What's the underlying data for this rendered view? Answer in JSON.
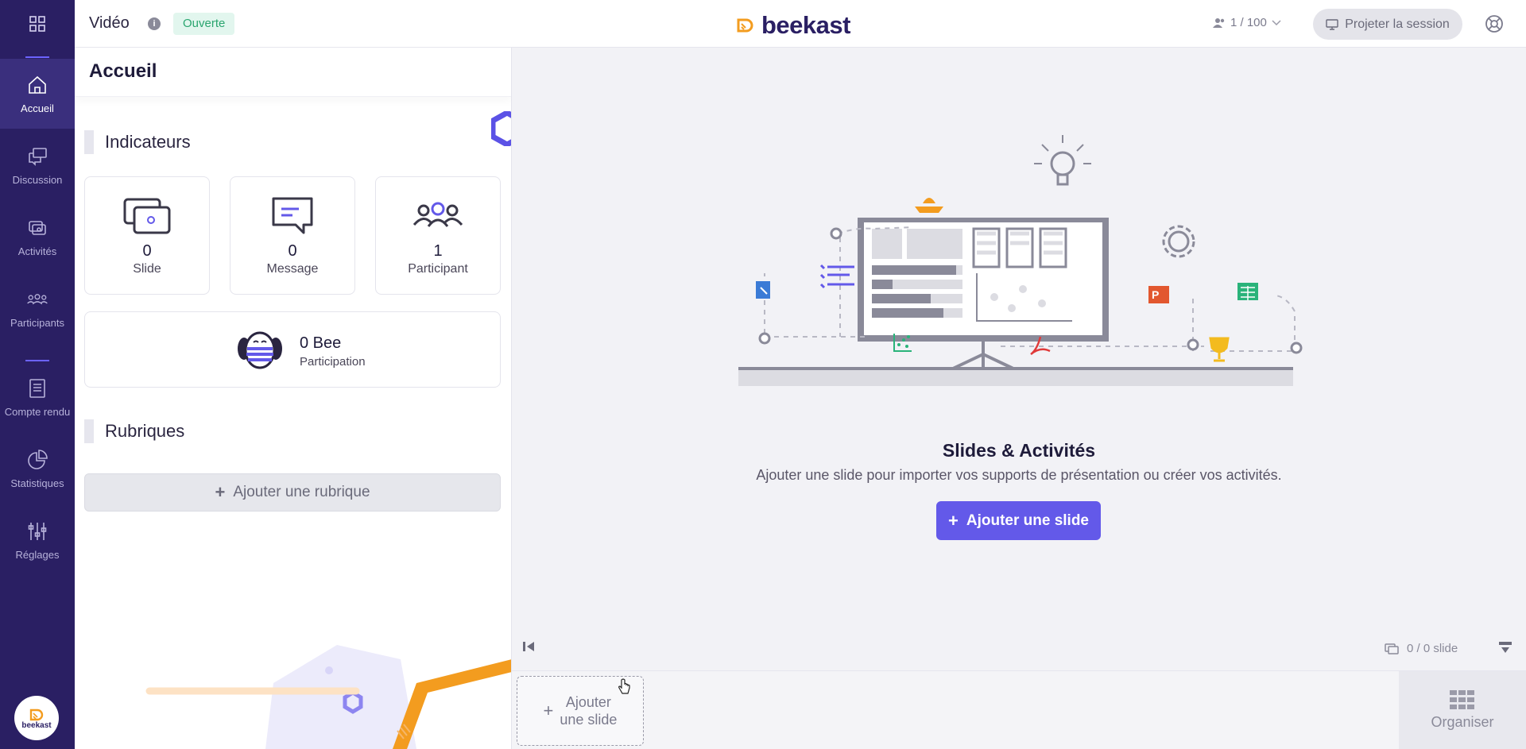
{
  "sidebar": {
    "apps_icon": "apps-grid-icon",
    "items": [
      {
        "label": "Accueil",
        "icon": "home-icon",
        "active": true
      },
      {
        "label": "Discussion",
        "icon": "chat-icon"
      },
      {
        "label": "Activités",
        "icon": "activities-icon"
      },
      {
        "label": "Participants",
        "icon": "participants-icon"
      },
      {
        "label": "Compte rendu",
        "icon": "report-icon"
      },
      {
        "label": "Statistiques",
        "icon": "pie-chart-icon"
      },
      {
        "label": "Réglages",
        "icon": "sliders-icon"
      }
    ],
    "logo_text": "beekast"
  },
  "topbar": {
    "session_title": "Vidéo",
    "status_badge": "Ouverte",
    "brand": "beekast",
    "participants": "1 / 100",
    "project_button": "Projeter la session"
  },
  "leftpanel": {
    "title": "Accueil",
    "indicators_title": "Indicateurs",
    "indicators": [
      {
        "value": "0",
        "label": "Slide",
        "icon": "slides-icon"
      },
      {
        "value": "0",
        "label": "Message",
        "icon": "message-icon"
      },
      {
        "value": "1",
        "label": "Participant",
        "icon": "group-icon"
      }
    ],
    "bee": {
      "value": "0 Bee",
      "label": "Participation",
      "icon": "bee-icon"
    },
    "rubriques_title": "Rubriques",
    "add_rubrique": "Ajouter une rubrique"
  },
  "main": {
    "title": "Slides & Activités",
    "subtitle": "Ajouter une slide pour importer vos supports de présentation ou créer vos activités.",
    "add_button": "Ajouter une slide",
    "slide_count": "0 / 0 slide"
  },
  "strip": {
    "add_line1": "Ajouter",
    "add_line2": "une slide",
    "organize": "Organiser"
  },
  "colors": {
    "sidebar": "#2a1f63",
    "accent": "#6359e9",
    "badge_bg": "#e2f6ee",
    "badge_text": "#2aa56f",
    "brand_orange": "#f39c1f"
  }
}
